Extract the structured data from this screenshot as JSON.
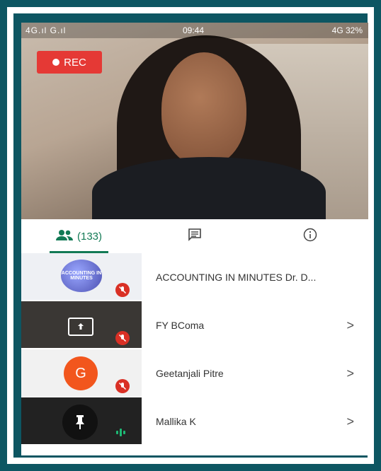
{
  "status_bar": {
    "left": "4G.ıl G.ıl",
    "time": "09:44",
    "right": "4G 32%"
  },
  "recording": {
    "label": "REC"
  },
  "tabs": {
    "people_count": "(133)"
  },
  "participants": [
    {
      "name": "ACCOUNTING IN MINUTES Dr. D...",
      "thumb_text": "ACCOUNTING IN MINUTES",
      "muted": true
    },
    {
      "name": "FY BComa",
      "muted": true,
      "presenting": true
    },
    {
      "name": "Geetanjali Pitre",
      "initial": "G",
      "muted": true
    },
    {
      "name": "Mallika K",
      "muted": false,
      "speaking": true
    }
  ],
  "colors": {
    "accent": "#127a55",
    "rec": "#e53935",
    "muted": "#d93025",
    "avatar_g": "#f2561d",
    "frame": "#0d5662"
  }
}
